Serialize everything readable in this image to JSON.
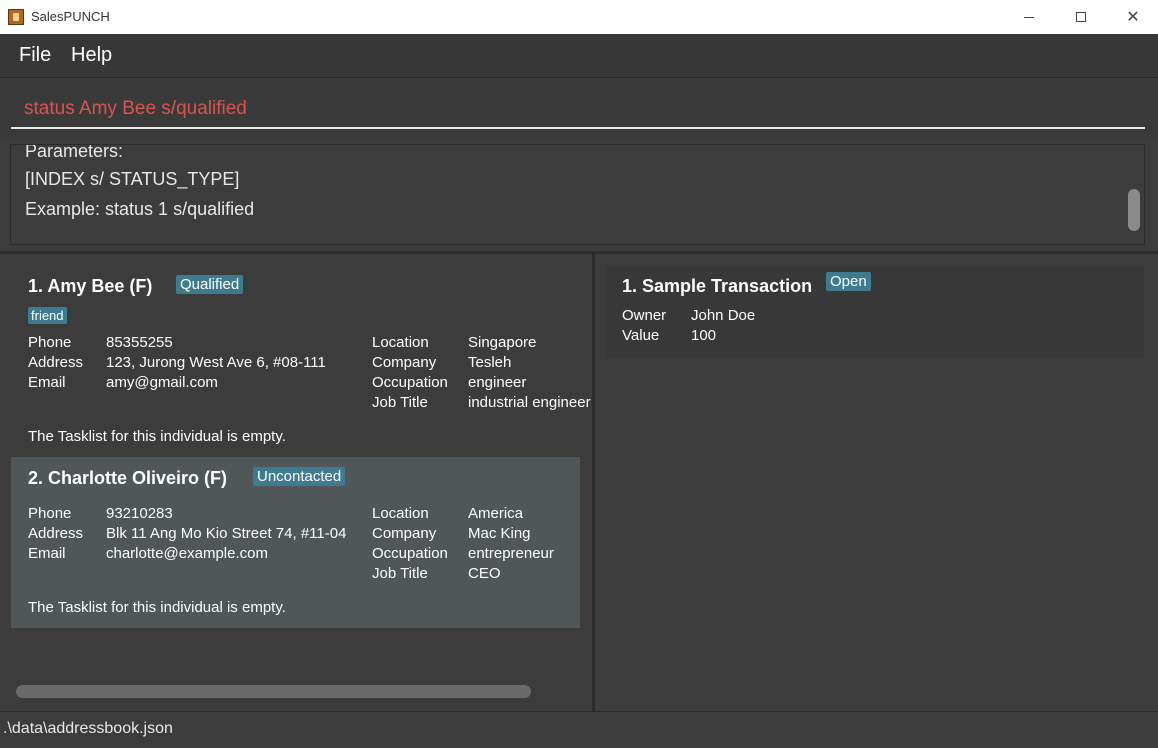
{
  "window": {
    "title": "SalesPUNCH"
  },
  "menu": {
    "file": "File",
    "help": "Help"
  },
  "command": {
    "value": "status Amy Bee s/qualified"
  },
  "result": {
    "lines": [
      "Parameters:",
      "[INDEX s/ STATUS_TYPE]",
      "Example: status 1 s/qualified"
    ]
  },
  "persons": [
    {
      "name": "1.  Amy Bee   (F)",
      "status": "Qualified",
      "tag": "friend",
      "labels": {
        "phone": "Phone",
        "address": "Address",
        "email": "Email",
        "location": "Location",
        "company": "Company",
        "occupation": "Occupation",
        "job_title": "Job Title"
      },
      "phone": "85355255",
      "address": "123, Jurong West Ave 6, #08-111",
      "email": "amy@gmail.com",
      "location": "Singapore",
      "company": "Tesleh",
      "occupation": "engineer",
      "job_title": "industrial engineer",
      "tasklist": "The Tasklist for this individual is empty."
    },
    {
      "name": "2.  Charlotte Oliveiro   (F)",
      "status": "Uncontacted",
      "labels": {
        "phone": "Phone",
        "address": "Address",
        "email": "Email",
        "location": "Location",
        "company": "Company",
        "occupation": "Occupation",
        "job_title": "Job Title"
      },
      "phone": "93210283",
      "address": "Blk 11 Ang Mo Kio Street 74, #11-04",
      "email": "charlotte@example.com",
      "location": "America",
      "company": "Mac King",
      "occupation": "entrepreneur",
      "job_title": "CEO",
      "tasklist": "The Tasklist for this individual is empty."
    }
  ],
  "transactions": [
    {
      "name": "1.  Sample Transaction",
      "status": "Open",
      "owner_label": "Owner",
      "owner": "John Doe",
      "value_label": "Value",
      "value": "100"
    }
  ],
  "statusbar": {
    "path": ".\\data\\addressbook.json"
  },
  "colors": {
    "accent_badge": "#3e7b91",
    "command_text": "#d9534f",
    "selected_card": "#515658"
  }
}
